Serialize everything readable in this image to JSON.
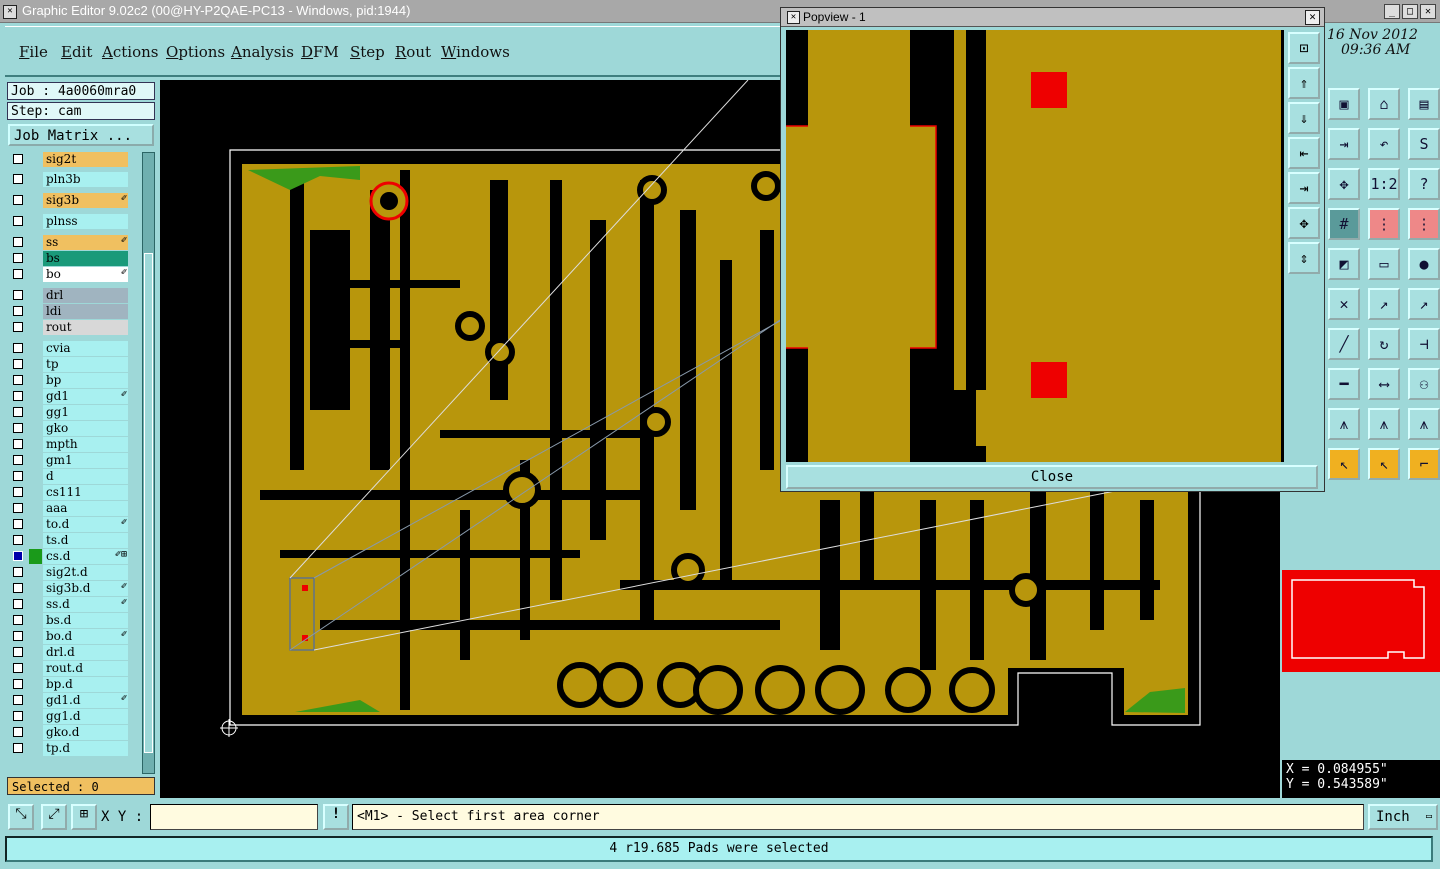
{
  "window": {
    "title": "Graphic Editor 9.02c2 (00@HY-P2QAE-PC13 - Windows, pid:1944)"
  },
  "menu": [
    "File",
    "Edit",
    "Actions",
    "Options",
    "Analysis",
    "DFM",
    "Step",
    "Rout",
    "Windows"
  ],
  "job": {
    "job_label": "Job : 4a0060mra0",
    "step_label": "Step: cam",
    "matrix_button": "Job Matrix ..."
  },
  "layers": [
    {
      "name": "sig2t",
      "color": "#f0c060"
    },
    {
      "name": "pln3b",
      "color": "#a8f0f0"
    },
    {
      "name": "sig3b",
      "color": "#f0c060",
      "mark": "✐"
    },
    {
      "name": "plnss",
      "color": "#a8f0f0"
    },
    {
      "name": "ss",
      "color": "#f0c060",
      "mark": "✐"
    },
    {
      "name": "bs",
      "color": "#1a9a7a"
    },
    {
      "name": "bo",
      "color": "#ffffff",
      "mark": "✐"
    },
    {
      "name": "drl",
      "color": "#a0b4c0"
    },
    {
      "name": "ldi",
      "color": "#a0b4c0"
    },
    {
      "name": "rout",
      "color": "#d8d8d8"
    },
    {
      "name": "cvia",
      "color": "#a8f0f0"
    },
    {
      "name": "tp",
      "color": "#a8f0f0"
    },
    {
      "name": "bp",
      "color": "#a8f0f0"
    },
    {
      "name": "gd1",
      "color": "#a8f0f0",
      "mark": "✐"
    },
    {
      "name": "gg1",
      "color": "#a8f0f0"
    },
    {
      "name": "gko",
      "color": "#a8f0f0"
    },
    {
      "name": "mpth",
      "color": "#a8f0f0"
    },
    {
      "name": "gm1",
      "color": "#a8f0f0"
    },
    {
      "name": "d",
      "color": "#a8f0f0"
    },
    {
      "name": "cs111",
      "color": "#a8f0f0"
    },
    {
      "name": "aaa",
      "color": "#a8f0f0"
    },
    {
      "name": "to.d",
      "color": "#a8f0f0",
      "mark": "✐"
    },
    {
      "name": "ts.d",
      "color": "#a8f0f0"
    },
    {
      "name": "cs.d",
      "color": "#a8f0f0",
      "mark": "✐⊞"
    },
    {
      "name": "sig2t.d",
      "color": "#a8f0f0"
    },
    {
      "name": "sig3b.d",
      "color": "#a8f0f0",
      "mark": "✐"
    },
    {
      "name": "ss.d",
      "color": "#a8f0f0",
      "mark": "✐"
    },
    {
      "name": "bs.d",
      "color": "#a8f0f0"
    },
    {
      "name": "bo.d",
      "color": "#a8f0f0",
      "mark": "✐"
    },
    {
      "name": "drl.d",
      "color": "#a8f0f0"
    },
    {
      "name": "rout.d",
      "color": "#a8f0f0"
    },
    {
      "name": "bp.d",
      "color": "#a8f0f0"
    },
    {
      "name": "gd1.d",
      "color": "#a8f0f0",
      "mark": "✐"
    },
    {
      "name": "gg1.d",
      "color": "#a8f0f0"
    },
    {
      "name": "gko.d",
      "color": "#a8f0f0"
    },
    {
      "name": "tp.d",
      "color": "#a8f0f0"
    }
  ],
  "selected_label": "Selected : 0",
  "popview": {
    "title": "Popview - 1",
    "close_label": "Close"
  },
  "clock": {
    "date": "16 Nov 2012",
    "time": "09:36 AM"
  },
  "coords": {
    "x": "X = 0.084955\"",
    "y": "Y = 0.543589\""
  },
  "command": {
    "xy_label": "X Y :",
    "xy_value": "",
    "prompt": "<M1> - Select first area corner",
    "unit": "Inch"
  },
  "status": "4 r19.685 Pads were selected",
  "colors": {
    "copper": "#b8960c",
    "selection": "#ee0000",
    "ui": "#9ed8d8"
  },
  "icons": [
    "zoom-icon",
    "pan-icon",
    "home-icon",
    "grid-icon",
    "snap-icon",
    "measure-icon",
    "help-icon",
    "select-icon"
  ]
}
